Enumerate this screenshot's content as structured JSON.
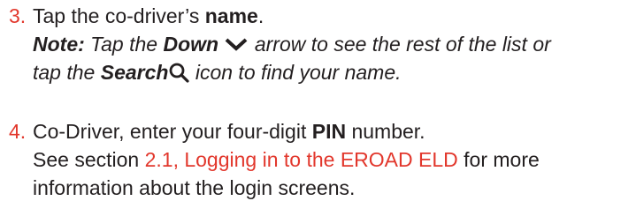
{
  "steps": [
    {
      "number": "3.",
      "text_before": "Tap the co-driver’s ",
      "bold": "name",
      "text_after": ".",
      "note": {
        "label": "Note:",
        "part1": " Tap the ",
        "down_label": "Down",
        "down_icon": "chevron-down-icon",
        "part2": " arrow to see the rest of the list or",
        "part3": "tap the ",
        "search_label": "Search",
        "search_icon": "search-icon",
        "part4": " icon to find your name."
      }
    },
    {
      "number": "4.",
      "line1_before": "Co-Driver, enter your four-digit ",
      "line1_bold": "PIN",
      "line1_after": " number.",
      "line2_before": "See section ",
      "line2_link": "2.1, Logging in to the EROAD ELD",
      "line2_after": " for more",
      "line3": "information about the login screens."
    }
  ],
  "colors": {
    "accent": "#e2372c",
    "text": "#231f20"
  }
}
